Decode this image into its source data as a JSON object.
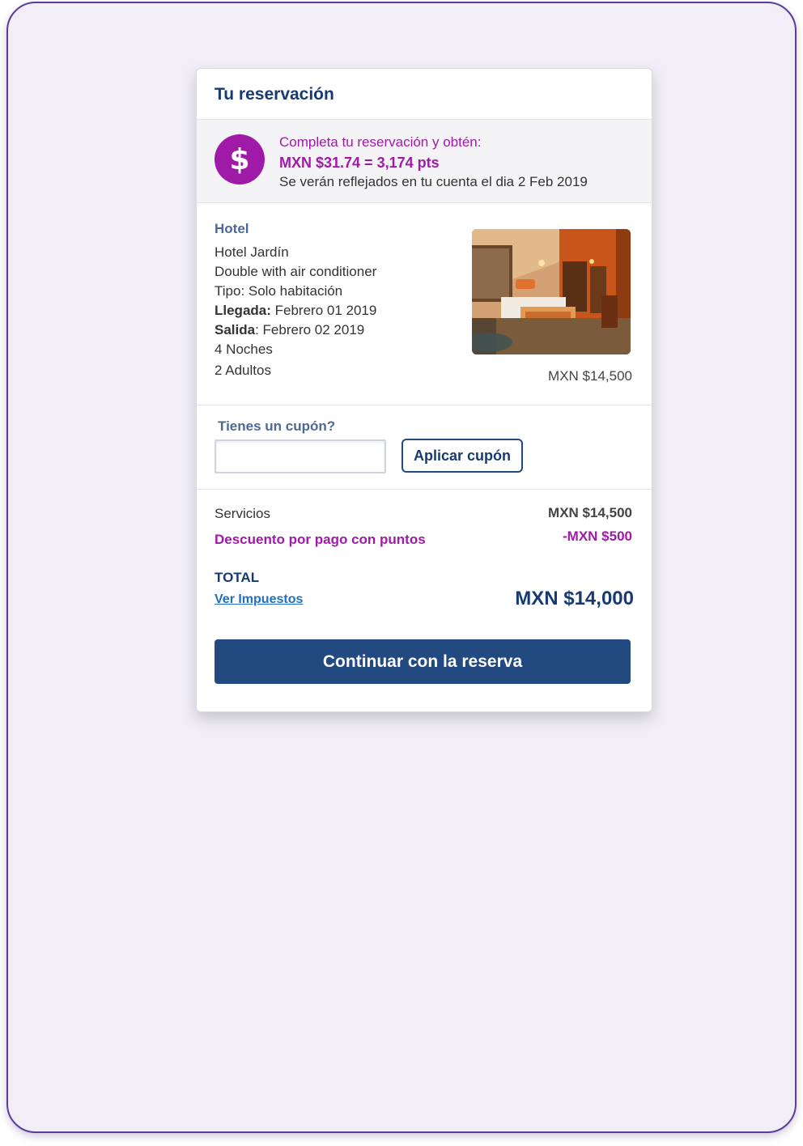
{
  "card": {
    "title": "Tu reservación"
  },
  "points_banner": {
    "icon": "dollar-icon",
    "icon_glyph": "$",
    "line1": "Completa tu reservación y obtén:",
    "line2": "MXN $31.74 = 3,174 pts",
    "line3": "Se verán reflejados en tu cuenta el dia 2 Feb 2019"
  },
  "hotel": {
    "heading": "Hotel",
    "name": "Hotel Jardín",
    "room": "Double with air conditioner",
    "type": "Tipo: Solo habitación",
    "arrival_label": "Llegada:",
    "arrival_value": " Febrero 01 2019",
    "departure_label": "Salida",
    "departure_value": ": Febrero 02 2019",
    "nights": "4 Noches",
    "adults": "2 Adultos",
    "price": "MXN $14,500"
  },
  "coupon": {
    "label": "Tienes un cupón?",
    "input_value": "",
    "button_label": "Aplicar cupón"
  },
  "summary": {
    "services_label": "Servicios",
    "services_value": "MXN $14,500",
    "discount_label": "Descuento por pago con puntos",
    "discount_value": "-MXN $500",
    "total_label": "TOTAL",
    "tax_link": "Ver Impuestos",
    "total_value": "MXN $14,000"
  },
  "actions": {
    "continue_label": "Continuar con la reserva"
  },
  "colors": {
    "brand_blue": "#234a80",
    "accent_purple": "#a01aa8",
    "frame_background": "#f1eef8"
  }
}
